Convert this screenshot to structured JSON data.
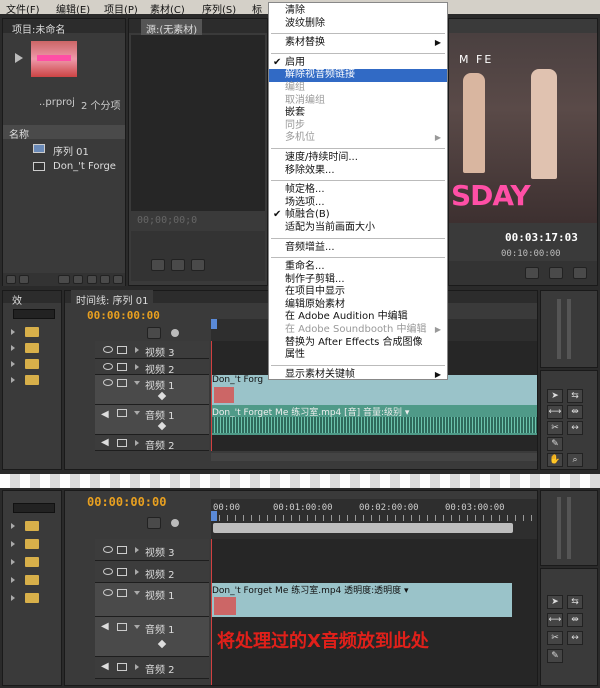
{
  "menubar": {
    "items": [
      "文件(F)",
      "编辑(E)",
      "项目(P)",
      "素材(C)",
      "序列(S)",
      "标"
    ]
  },
  "project_panel": {
    "tab": "项目:未命名",
    "file_label": "..prproj",
    "item_count": "2 个分项",
    "column_name": "名称",
    "items": [
      "序列 01",
      "Don_'t Forge"
    ]
  },
  "source_monitor": {
    "tab": "源:(无素材)",
    "timecode": "00;00;00;0"
  },
  "program_monitor": {
    "overlay_text_top": "M FE",
    "overlay_text_bottom": "SDAY",
    "timecode_duration": "00:03:17:03",
    "ruler_time": "00:10:00:00"
  },
  "context_menu": {
    "items": [
      {
        "label": "清除",
        "disabled": false
      },
      {
        "label": "波纹删除",
        "disabled": false
      },
      {
        "sep": true
      },
      {
        "label": "素材替换",
        "submenu": true
      },
      {
        "sep": true
      },
      {
        "label": "启用",
        "checked": true
      },
      {
        "label": "解除视音频链接",
        "highlight": true
      },
      {
        "label": "编组",
        "disabled": true
      },
      {
        "label": "取消编组",
        "disabled": true
      },
      {
        "label": "嵌套",
        "disabled": false
      },
      {
        "label": "同步",
        "disabled": true
      },
      {
        "label": "多机位",
        "disabled": true,
        "submenu": true
      },
      {
        "sep": true
      },
      {
        "label": "速度/持续时间..."
      },
      {
        "label": "移除效果..."
      },
      {
        "sep": true
      },
      {
        "label": "帧定格..."
      },
      {
        "label": "场选项..."
      },
      {
        "label": "帧融合(B)",
        "checked": true
      },
      {
        "label": "适配为当前画面大小"
      },
      {
        "sep": true
      },
      {
        "label": "音频增益..."
      },
      {
        "sep": true
      },
      {
        "label": "重命名..."
      },
      {
        "label": "制作子剪辑..."
      },
      {
        "label": "在项目中显示"
      },
      {
        "label": "编辑原始素材"
      },
      {
        "label": "在 Adobe Audition 中编辑"
      },
      {
        "label": "在 Adobe Soundbooth 中编辑",
        "disabled": true,
        "submenu": true
      },
      {
        "label": "替换为 After Effects 合成图像"
      },
      {
        "label": "属性"
      },
      {
        "sep": true
      },
      {
        "label": "显示素材关键帧",
        "submenu": true
      }
    ]
  },
  "effects_panel": {
    "tab": "效"
  },
  "timeline_top": {
    "tab": "时间线: 序列 01",
    "timecode": "00:00:00:00",
    "tracks": [
      {
        "name": "视频 3"
      },
      {
        "name": "视频 2"
      },
      {
        "name": "视频 1"
      },
      {
        "name": "音频 1"
      },
      {
        "name": "音频 2"
      }
    ],
    "video_clip": "Don_'t Forg",
    "audio_clip": "Don_'t Forget Me 练习室.mp4 [音] 音量:级别 ▾"
  },
  "timeline_bottom": {
    "timecode": "00:00:00:00",
    "ruler": [
      "00:00",
      "00:01:00:00",
      "00:02:00:00",
      "00:03:00:00"
    ],
    "tracks": [
      {
        "name": "视频 3"
      },
      {
        "name": "视频 2"
      },
      {
        "name": "视频 1"
      },
      {
        "name": "音频 1"
      },
      {
        "name": "音频 2"
      }
    ],
    "video_clip": "Don_'t Forget Me 练习室.mp4 透明度:透明度 ▾",
    "annotation": "将处理过的X音频放到此处"
  },
  "colors": {
    "menu_highlight": "#316ac5",
    "timecode": "#e8a020",
    "annotation": "#e0201a",
    "video_clip": "#9ac3c9",
    "audio_clip": "#4f9a88"
  }
}
